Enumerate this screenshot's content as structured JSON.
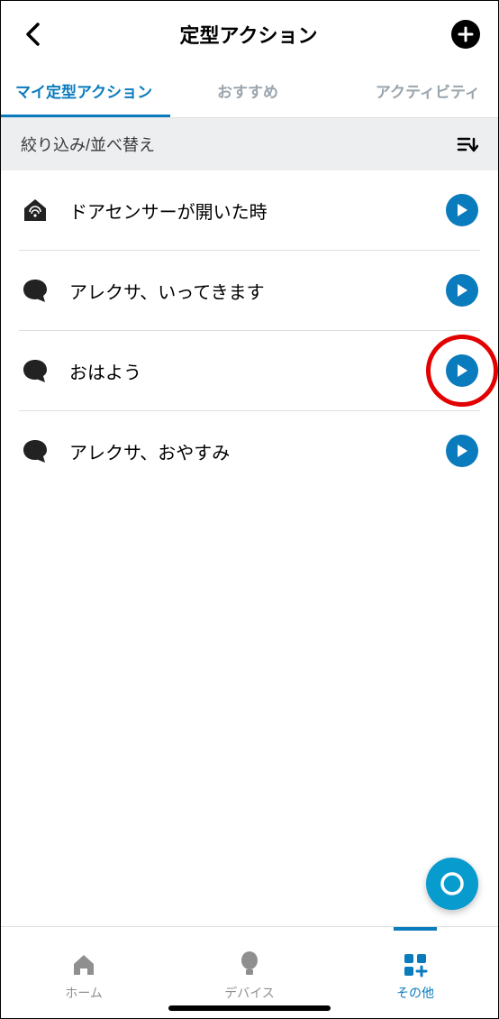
{
  "header": {
    "title": "定型アクション"
  },
  "tabs": [
    {
      "label": "マイ定型アクション",
      "active": true
    },
    {
      "label": "おすすめ",
      "active": false
    },
    {
      "label": "アクティビティ",
      "active": false
    }
  ],
  "filter": {
    "label": "絞り込み/並べ替え"
  },
  "routines": [
    {
      "icon": "home-sensor",
      "label": "ドアセンサーが開いた時",
      "highlighted": false
    },
    {
      "icon": "voice",
      "label": "アレクサ、いってきます",
      "highlighted": false
    },
    {
      "icon": "voice",
      "label": "おはよう",
      "highlighted": true
    },
    {
      "icon": "voice",
      "label": "アレクサ、おやすみ",
      "highlighted": false
    }
  ],
  "bottom_nav": [
    {
      "label": "ホーム",
      "active": false
    },
    {
      "label": "デバイス",
      "active": false
    },
    {
      "label": "その他",
      "active": true
    }
  ],
  "colors": {
    "accent": "#0a7bbd",
    "fab": "#089bce",
    "highlight": "#e30000"
  }
}
